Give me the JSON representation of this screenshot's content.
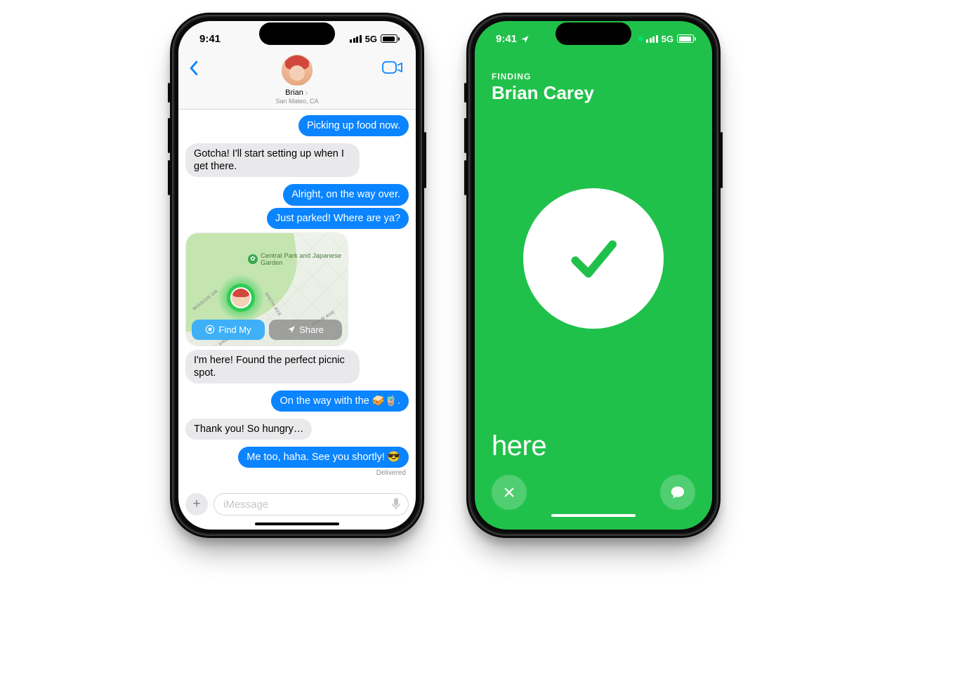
{
  "status": {
    "time": "9:41",
    "network": "5G"
  },
  "messages": {
    "contact": {
      "name": "Brian",
      "location": "San Mateo, CA"
    },
    "thread": [
      {
        "dir": "out",
        "text": "Picking up food now."
      },
      {
        "dir": "in",
        "text": "Gotcha! I'll start setting up when I get there."
      },
      {
        "dir": "out",
        "text": "Alright, on the way over."
      },
      {
        "dir": "out",
        "text": "Just parked! Where are ya?"
      }
    ],
    "map": {
      "poi": "Central Park and Japanese Garden",
      "streets": [
        "MISSION DR",
        "NINTH AVE",
        "PALM AVE",
        "LANE AVE"
      ],
      "find_my": "Find My",
      "share": "Share"
    },
    "thread2": [
      {
        "dir": "in",
        "text": "I'm here! Found the perfect picnic spot."
      },
      {
        "dir": "out",
        "text": "On the way with the 🥪🧋."
      },
      {
        "dir": "in",
        "text": "Thank you! So hungry…"
      },
      {
        "dir": "out",
        "text": "Me too, haha. See you shortly! 😎"
      }
    ],
    "delivered": "Delivered",
    "input_placeholder": "iMessage"
  },
  "findmy": {
    "eyebrow": "FINDING",
    "name": "Brian Carey",
    "status": "here"
  }
}
